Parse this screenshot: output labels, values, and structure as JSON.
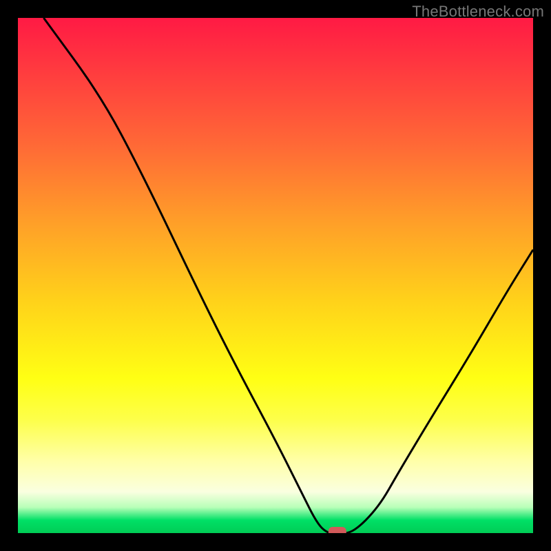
{
  "watermark": "TheBottleneck.com",
  "chart_data": {
    "type": "line",
    "title": "",
    "xlabel": "",
    "ylabel": "",
    "xlim": [
      0,
      100
    ],
    "ylim": [
      0,
      100
    ],
    "x": [
      5,
      16,
      24,
      35,
      42,
      50,
      55,
      58,
      60,
      62,
      65,
      70,
      74,
      80,
      88,
      95,
      100
    ],
    "y": [
      100,
      85,
      70,
      47,
      33,
      18,
      8,
      2,
      0,
      0,
      0,
      5,
      12,
      22,
      35,
      47,
      55
    ],
    "marker": {
      "x": 62,
      "y": 0
    },
    "note": "Bottleneck.com style V-curve over rainbow vertical gradient. x and y are relative percentages of the plot area; y=0 sits on the green band at the bottom, y=100 at the top red edge."
  }
}
